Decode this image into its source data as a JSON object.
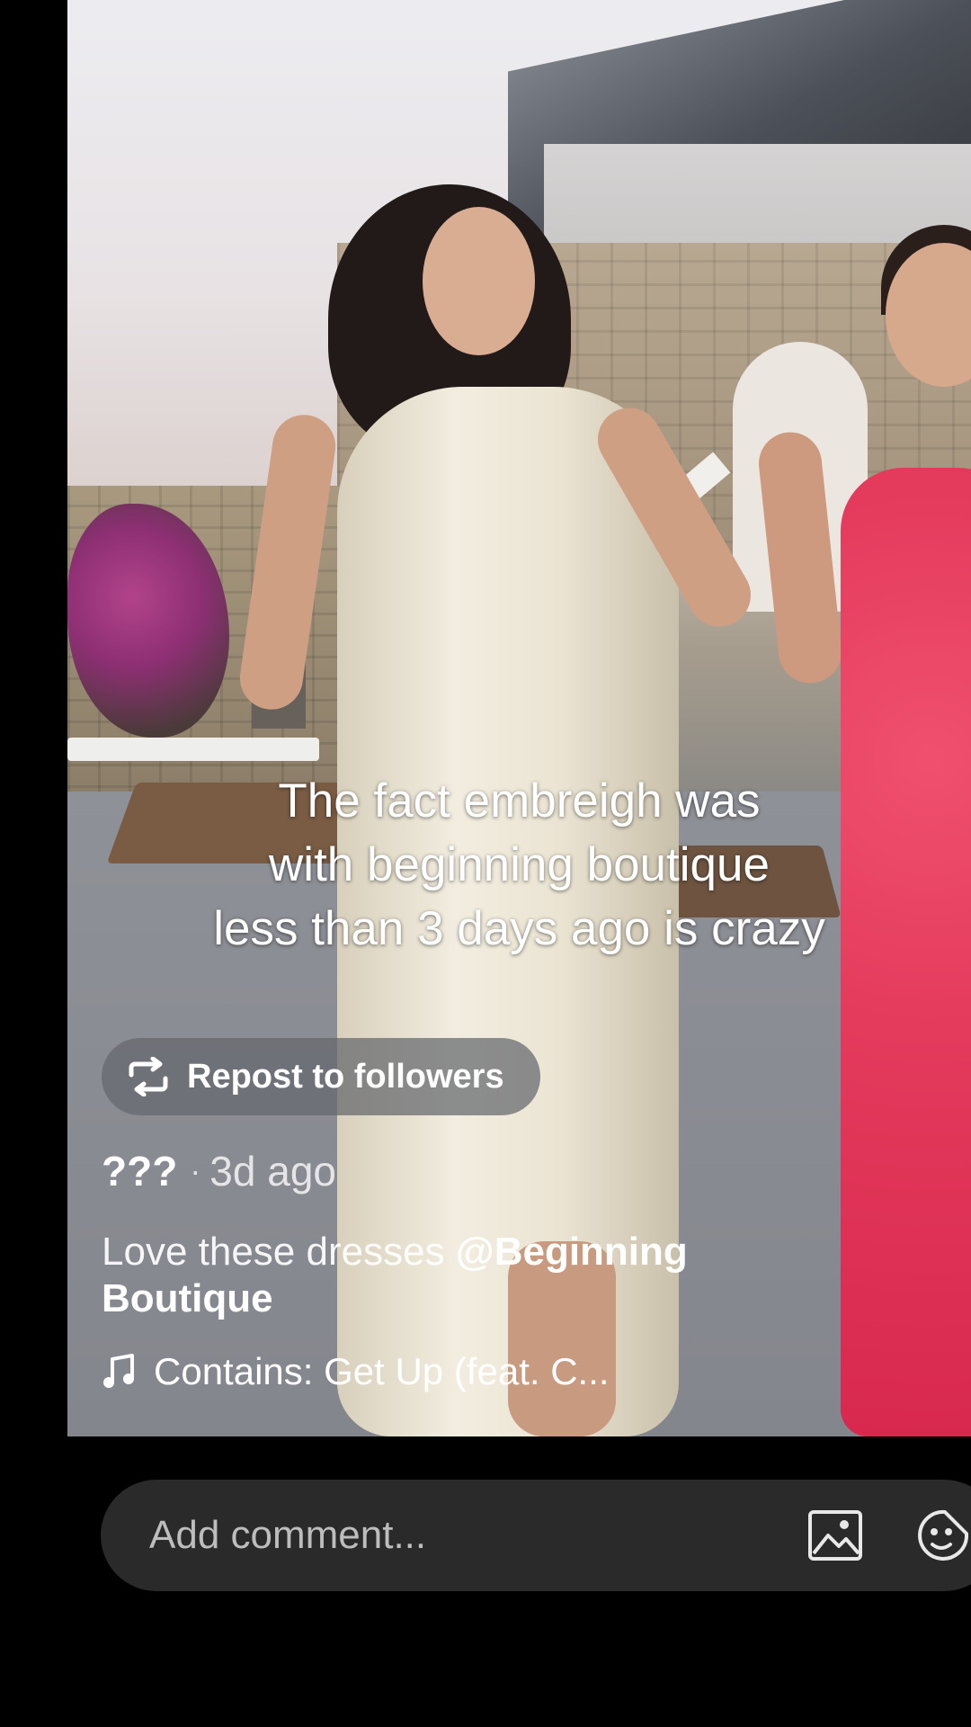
{
  "video": {
    "caption": "The fact embreigh was\nwith beginning boutique\nless than 3 days ago is crazy"
  },
  "repost": {
    "label": "Repost to followers",
    "icon": "repost-icon"
  },
  "post": {
    "username": "???",
    "separator": "·",
    "time": "3d ago",
    "description_text": "Love these dresses ",
    "mention": "@Beginning Boutique",
    "music": "Contains: Get Up (feat. C..."
  },
  "comment": {
    "placeholder": "Add comment...",
    "image_icon": "image-icon",
    "emoji_icon": "emoji-icon"
  }
}
